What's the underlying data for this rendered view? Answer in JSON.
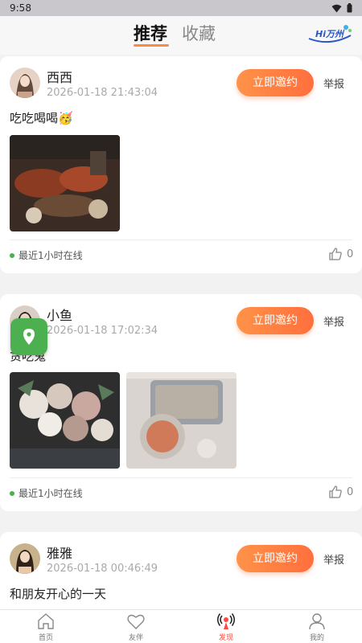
{
  "status_bar": {
    "time": "9:58"
  },
  "header": {
    "tabs": [
      {
        "label": "推荐",
        "active": true
      },
      {
        "label": "收藏",
        "active": false
      }
    ],
    "logo_text": "Hi万州"
  },
  "posts": [
    {
      "username": "西西",
      "timestamp": "2026-01-18 21:43:04",
      "invite_label": "立即邀约",
      "report_label": "举报",
      "text": "吃吃喝喝🥳",
      "online_status": "最近1小时在线",
      "likes": "0"
    },
    {
      "username": "小鱼",
      "timestamp": "2026-01-18 17:02:34",
      "invite_label": "立即邀约",
      "report_label": "举报",
      "text": "贪吃鬼",
      "online_status": "最近1小时在线",
      "likes": "0"
    },
    {
      "username": "雅雅",
      "timestamp": "2026-01-18 00:46:49",
      "invite_label": "立即邀约",
      "report_label": "举报",
      "text": "和朋友开心的一天"
    }
  ],
  "bottom_nav": [
    {
      "label": "首页",
      "icon": "home-icon",
      "active": false
    },
    {
      "label": "友伴",
      "icon": "heart-icon",
      "active": false
    },
    {
      "label": "发现",
      "icon": "broadcast-icon",
      "active": true
    },
    {
      "label": "我的",
      "icon": "person-icon",
      "active": false
    }
  ],
  "colors": {
    "accent": "#ff7a3d",
    "online": "#4caf50",
    "active_nav": "#ff4a3d",
    "fab": "#4caf50"
  }
}
